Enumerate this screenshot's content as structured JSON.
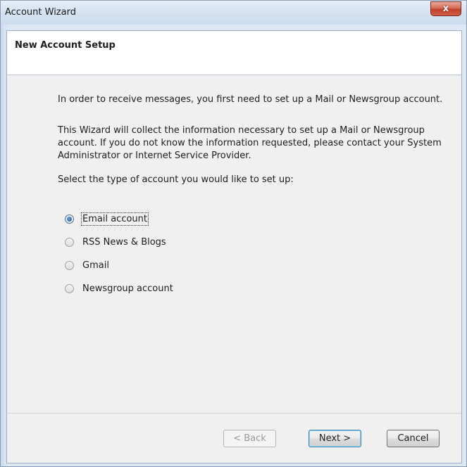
{
  "window": {
    "title": "Account Wizard",
    "close_label": "x"
  },
  "header": {
    "title": "New Account Setup"
  },
  "content": {
    "paragraph_1": "In order to receive messages, you first need to set up a Mail or Newsgroup account.",
    "paragraph_2": "This Wizard will collect the information necessary to set up a Mail or Newsgroup account. If you do not know the information requested, please contact your System Administrator or Internet Service Provider.",
    "prompt": "Select the type of account you would like to set up:",
    "options": [
      {
        "label": "Email account",
        "checked": true
      },
      {
        "label": "RSS News & Blogs",
        "checked": false
      },
      {
        "label": "Gmail",
        "checked": false
      },
      {
        "label": "Newsgroup account",
        "checked": false
      }
    ]
  },
  "footer": {
    "back_label": "< Back",
    "next_label": "Next >",
    "cancel_label": "Cancel"
  },
  "colors": {
    "frame": "#dde8f4",
    "panel": "#f0f0f0",
    "close_button": "#c2412a",
    "radio_checked": "#1f4e8c"
  }
}
